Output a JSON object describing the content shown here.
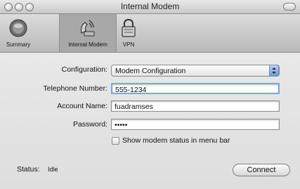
{
  "window": {
    "title": "Internal Modem"
  },
  "toolbar": {
    "items": [
      {
        "label": "Summary",
        "icon": "summary-icon"
      },
      {
        "label": "Internal Modem",
        "icon": "modem-icon",
        "selected": true
      },
      {
        "label": "VPN",
        "icon": "vpn-lock-icon"
      }
    ]
  },
  "form": {
    "configuration_label": "Configuration:",
    "configuration_value": "Modem Configuration",
    "telephone_label": "Telephone Number:",
    "telephone_value": "555-1234",
    "account_label": "Account Name:",
    "account_value": "fuadramses",
    "password_label": "Password:",
    "password_value": "•••••",
    "show_status_label": "Show modem status in menu bar",
    "show_status_checked": false
  },
  "status": {
    "label": "Status:",
    "value": "Idle"
  },
  "connect_button": {
    "label": "Connect"
  },
  "colors": {
    "accent": "#6c9ad5",
    "background_stripe": "#dceef6"
  }
}
